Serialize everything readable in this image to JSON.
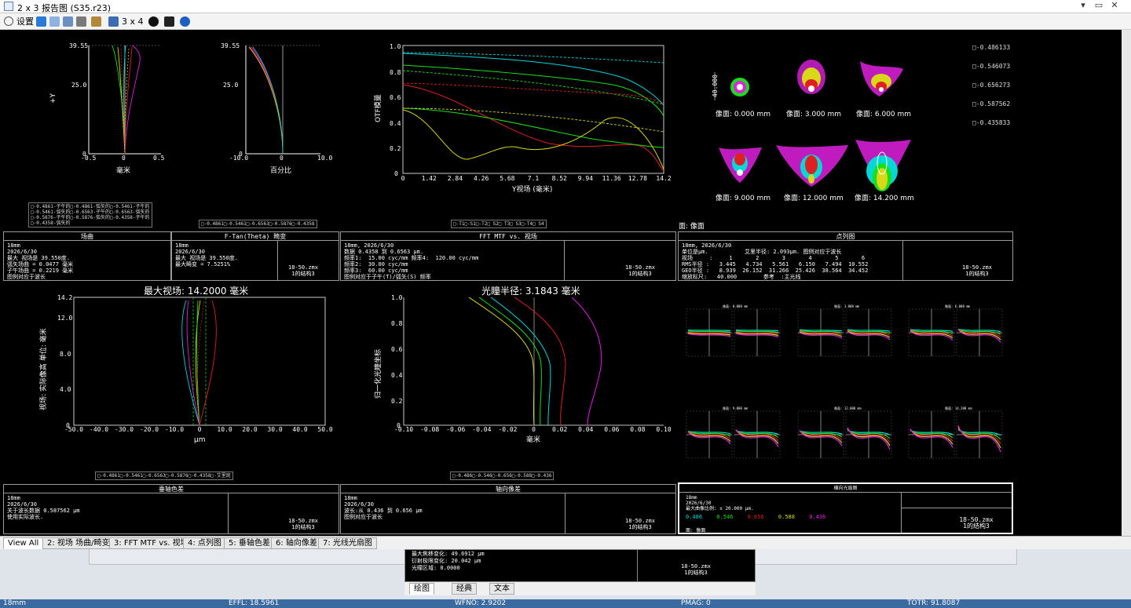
{
  "window": {
    "title": "2 x 3 报告图 (S35.r23)",
    "minimize": "▾",
    "restore": "▭",
    "close": "✕"
  },
  "toolbar": {
    "settings_label": "设置",
    "layout_label": "3 x 4"
  },
  "field_curvature": {
    "y_axis_label": "+Y",
    "y_top": "39.55",
    "y_mid": "25.0",
    "y_zero": "0",
    "x_ticks": [
      "-0.5",
      "0",
      "0.5"
    ],
    "x_unit": "毫米",
    "legend": "□-0.4861-子午的□-0.4861-弧矢的□-0.5461-子午的\n□-0.5461-弧矢的□-0.6563-子午的□-0.6563-弧矢的\n□-0.5876-子午的□-0.5876-弧矢的□-0.4358-子午的\n□-0.4358-弧矢的"
  },
  "distortion": {
    "y_top": "39.55",
    "y_mid": "25.0",
    "y_zero": "0",
    "x_ticks": [
      "-10.0",
      "0",
      "10.0"
    ],
    "x_unit": "百分比",
    "legend": "□-0.4861□-0.5461□-0.6563□-0.5876□-0.4358"
  },
  "mtf": {
    "y_label": "OTF模量",
    "y_ticks": [
      "1.0",
      "0.8",
      "0.6",
      "0.4",
      "0.2",
      "0"
    ],
    "x_ticks": [
      "0",
      "1.42",
      "2.84",
      "4.26",
      "5.68",
      "7.1",
      "8.52",
      "9.94",
      "11.36",
      "12.78",
      "14.2"
    ],
    "x_label": "Y视场 (毫米)",
    "legend": "□-T1□-S1□-T2□ S2□ T3□ S3□-T4□ S4"
  },
  "spot": {
    "scale_label": "40.000",
    "legend": [
      "□-0.486133",
      "□-0.546073",
      "□-0.656273",
      "□-0.587562",
      "□-0.435833"
    ],
    "labels": [
      "像面: 0.000 mm",
      "像面: 3.000 mm",
      "像面: 6.000 mm",
      "像面: 9.000 mm",
      "像面: 12.000 mm",
      "像面: 14.200 mm"
    ],
    "surface_label": "面: 像面"
  },
  "info_boxes": {
    "field": {
      "header": "场曲",
      "body": "18mm\n2026/6/30\n最大 视场是 39.550度.\n弧矢场曲 = 0.0477 毫米\n子午场曲 = 0.2219 毫米\n图例对应于波长"
    },
    "ftan": {
      "header": "F-Tan(Theta) 畸变",
      "body": "18mm\n2026/6/30\n最大 视场是 39.550度.\n最大畸变 = 7.5251%",
      "right": "18-50.zmx\n1的结构3"
    },
    "mtf": {
      "header": "FFT MTF vs. 视场",
      "body": "18mm, 2026/6/30\n数据 0.4358 到 0.6563 μm.\n频率1:  15.00 cyc/mm 频率4:  120.00 cyc/mm\n频率2:  30.00 cyc/mm\n频率3:  60.00 cyc/mm\n图例对应于子午(T)/弧矢(S) 频率",
      "right": "18-50.zmx\n1的结构3"
    },
    "spot": {
      "header": "点列图",
      "body": "18mm, 2026/6/30\n单位是μm.           艾里半径: 2.093μm. 图例对应于波长\n视场     :     1       2       3       4       5       6\nRMS半径 :   3.445   4.734   5.561   6.150   7.494  10.552\nGEO半径 :   8.939  26.152  31.266  25.426  38.564  34.452\n缩放标尺:   40.000        参考  :主光线",
      "right": "18-50.zmx\n1的结构3"
    },
    "lateral": {
      "header": "垂轴色差",
      "body": "18mm\n2026/6/30\n关于波长数据 0.587562 μm\n使用实际波长.",
      "right": "18-50.zmx\n1的结构3"
    },
    "axial": {
      "header": "轴向像差",
      "body": "18mm\n2026/6/30\n波长:从 0.436 到 0.656 μm\n图例对应于波长",
      "right": "18-50.zmx\n1的结构3"
    },
    "ray": {
      "header": "横向光扇图",
      "body": "18mm\n2026/6/30\n最大曲像比例: ± 20.000 μm.",
      "right": "18-50.zmx\n1的结构3",
      "surface": "面: 像面",
      "waves": [
        "0.486",
        "0.546",
        "0.656",
        "0.588",
        "0.436"
      ]
    }
  },
  "lateral_color": {
    "title": "最大视场: 14.2000 毫米",
    "y_label": "视场: 实际像高 单位: 毫米",
    "y_ticks": [
      "14.2",
      "12.0",
      "8.0",
      "4.0",
      "0"
    ],
    "x_ticks": [
      "-50.0",
      "-40.0",
      "-30.0",
      "-20.0",
      "-10.0",
      "0",
      "10.0",
      "20.0",
      "30.0",
      "40.0",
      "50.0"
    ],
    "x_unit": "μm",
    "legend": "□-0.4861□-0.5461□-0.6563□-0.5876□-0.4358□-艾里斑"
  },
  "axial": {
    "title": "光瞳半径: 3.1843 毫米",
    "y_label": "归一化光瞳坐标",
    "y_ticks": [
      "1.0",
      "0.8",
      "0.6",
      "0.4",
      "0.2",
      "0"
    ],
    "x_ticks": [
      "-0.10",
      "-0.08",
      "-0.06",
      "-0.04",
      "-0.02",
      "0",
      "0.02",
      "0.04",
      "0.06",
      "0.08",
      "0.10"
    ],
    "x_unit": "毫米",
    "legend": "□-0.486□-0.546□-0.656□-0.588□-0.436"
  },
  "ray_fan": {
    "titles": [
      "像面: 0.000 mm",
      "像面: 3.000 mm",
      "像面: 6.000 mm",
      "像面: 9.000 mm",
      "像面: 12.000 mm",
      "像面: 14.200 mm"
    ]
  },
  "tabs": [
    "View All",
    "2: 视场 场曲/畸变",
    "3: FFT MTF vs. 视场",
    "4: 点列图",
    "5: 垂轴色差",
    "6: 轴向像差",
    "7: 光线光扇图"
  ],
  "lower_panel": {
    "text": "最大焦移变化: 49.6912 μm\n衍射极限变化: 20.042 μm\n光瞳区域: 0.0000",
    "right": "18-50.zmx\n1的结构3",
    "tabs": [
      "绘图",
      "经典",
      "文本"
    ]
  },
  "status": {
    "s1": "18mm",
    "s2": "EFFL: 18.5961",
    "s3": "WFNO: 2.9202",
    "s4": "PMAG: 0",
    "s5": "TOTR: 91.8087"
  },
  "colors": {
    "w1": "#00d8d8",
    "w2": "#18e018",
    "w3": "#e02020",
    "w4": "#d8d818",
    "w5": "#e020e0",
    "accent": "#3b6aa1"
  }
}
